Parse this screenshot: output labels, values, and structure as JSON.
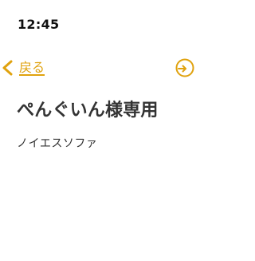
{
  "status_bar": {
    "time": "12:45"
  },
  "nav": {
    "back_label": "戻る",
    "back_icon": "chevron-left-icon",
    "action_icon": "circle-arrow-icon"
  },
  "content": {
    "title": "ぺんぐいん様専用",
    "subtitle": "ノイエスソファ"
  },
  "colors": {
    "accent": "#e0a20e",
    "text": "#333333",
    "background": "#ffffff"
  }
}
